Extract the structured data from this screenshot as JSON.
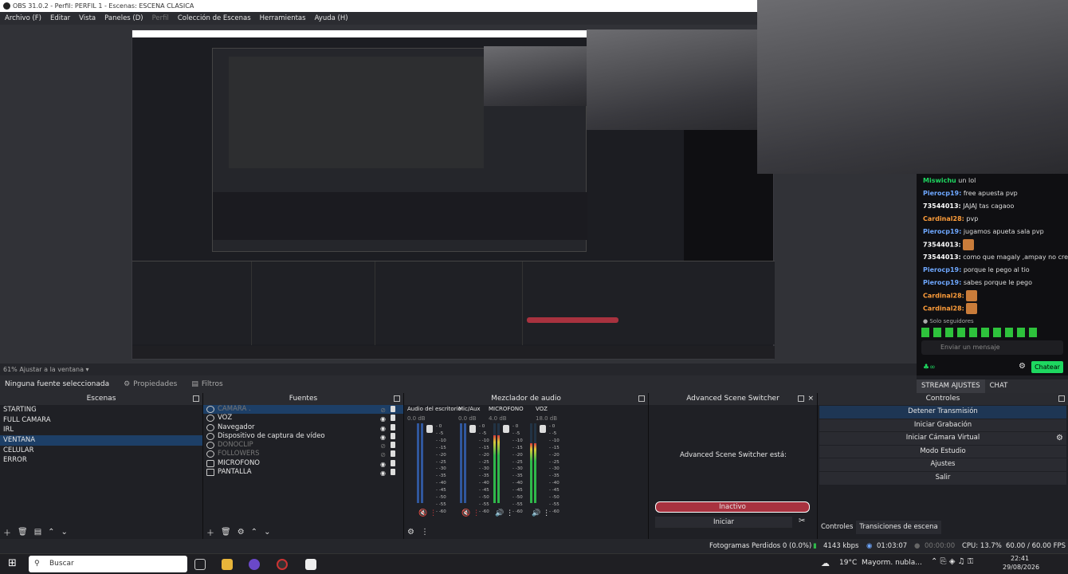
{
  "window": {
    "title": "OBS 31.0.2 - Perfil: PERFIL 1 - Escenas: ESCENA CLASICA"
  },
  "menu": [
    "Archivo (F)",
    "Editar",
    "Vista",
    "Paneles (D)",
    "Perfil",
    "Colección de Escenas",
    "Herramientas",
    "Ayuda (H)"
  ],
  "preview": {
    "zoom_label": "61% Ajustar a la ventana"
  },
  "chat": {
    "lines": [
      {
        "user": "Miswichu",
        "text": "un lol",
        "color": "green"
      },
      {
        "user": "Pierocp19:",
        "text": "free apuesta pvp"
      },
      {
        "user": "73544013:",
        "text": "JAJAJ tas cagaoo"
      },
      {
        "user": "Cardinal28:",
        "text": "pvp",
        "color": "orange"
      },
      {
        "user": "Pierocp19:",
        "text": "jugamos apueta sala pvp"
      },
      {
        "user": "73544013:",
        "text": ""
      },
      {
        "user": "73544013:",
        "text": "como que magaly ,ampay no creoo"
      },
      {
        "user": "Pierocp19:",
        "text": "porque le pego al tio"
      },
      {
        "user": "Pierocp19:",
        "text": "sabes porque le pego"
      },
      {
        "user": "Cardinal28:",
        "text": "",
        "color": "orange"
      },
      {
        "user": "Cardinal28:",
        "text": "",
        "color": "orange"
      }
    ],
    "followers_only": "Solo seguidores",
    "input_placeholder": "Enviar un mensaje",
    "send_label": "Chatear",
    "tabs": [
      "STREAM AJUSTES",
      "CHAT"
    ]
  },
  "source_toolbar": {
    "no_source": "Ninguna fuente seleccionada",
    "properties": "Propiedades",
    "filters": "Filtros"
  },
  "docks": {
    "scenes": {
      "title": "Escenas",
      "items": [
        "STARTING",
        "FULL CAMARA",
        "IRL",
        "VENTANA",
        "CELULAR",
        "ERROR"
      ],
      "selected": 3
    },
    "sources": {
      "title": "Fuentes",
      "items": [
        {
          "name": "CAMARA .",
          "dim": true,
          "sel": true
        },
        {
          "name": "VOZ"
        },
        {
          "name": "Navegador"
        },
        {
          "name": "Dispositivo de captura de vídeo"
        },
        {
          "name": "DONOCLIP",
          "dim": true
        },
        {
          "name": "FOLLOWERS",
          "dim": true
        },
        {
          "name": "MICROFONO"
        },
        {
          "name": "PANTALLA"
        }
      ]
    },
    "mixer": {
      "title": "Mezclador de audio",
      "channels": [
        {
          "name": "Audio del escritorio",
          "db": "0.0 dB",
          "level": 0.0,
          "color": "#3a6fd8",
          "muted": true
        },
        {
          "name": "Mic/Aux",
          "db": "0.0 dB",
          "level": 0.0,
          "color": "#3a6fd8",
          "muted": true
        },
        {
          "name": "MICROFONO",
          "db": "4.0 dB",
          "level": 0.85,
          "color": "#2fb84a",
          "muted": false
        },
        {
          "name": "VOZ",
          "db": "18.0 dB",
          "level": 0.75,
          "color": "#2fb84a",
          "muted": false
        }
      ],
      "ticks": [
        "0",
        "-5",
        "-10",
        "-15",
        "-20",
        "-25",
        "-30",
        "-35",
        "-40",
        "-45",
        "-50",
        "-55",
        "-60"
      ]
    },
    "switcher": {
      "title": "Advanced Scene Switcher",
      "status": "Advanced Scene Switcher está:",
      "state": "Inactivo",
      "start": "Iniciar"
    },
    "controls": {
      "title": "Controles",
      "buttons": [
        "Detener Transmisión",
        "Iniciar Grabación",
        "Iniciar Cámara Virtual",
        "Modo Estudio",
        "Ajustes",
        "Salir"
      ],
      "tabs": [
        "Controles",
        "Transiciones de escena"
      ]
    }
  },
  "status": {
    "dropped": "Fotogramas Perdidos 0 (0.0%)",
    "bitrate": "4143 kbps",
    "live_time": "01:03:07",
    "rec_time": "00:00:00",
    "cpu": "CPU: 13.7%",
    "fps": "60.00 / 60.00 FPS"
  },
  "taskbar": {
    "search": "Buscar",
    "weather_temp": "19°C",
    "weather_desc": "Mayorm. nubla...",
    "time": "22:41",
    "date": "29/08/2026"
  }
}
